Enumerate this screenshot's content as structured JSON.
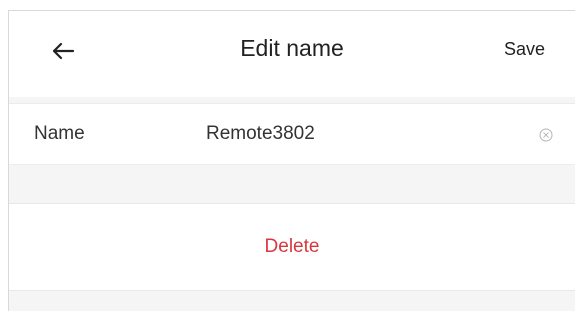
{
  "header": {
    "back_icon": "arrow-left-icon",
    "title": "Edit name",
    "save_label": "Save"
  },
  "form": {
    "name_label": "Name",
    "name_value": "Remote3802",
    "clear_icon": "clear-circle-icon"
  },
  "actions": {
    "delete_label": "Delete"
  },
  "colors": {
    "delete": "#d9373e",
    "text": "#222222",
    "background": "#f5f5f5"
  }
}
